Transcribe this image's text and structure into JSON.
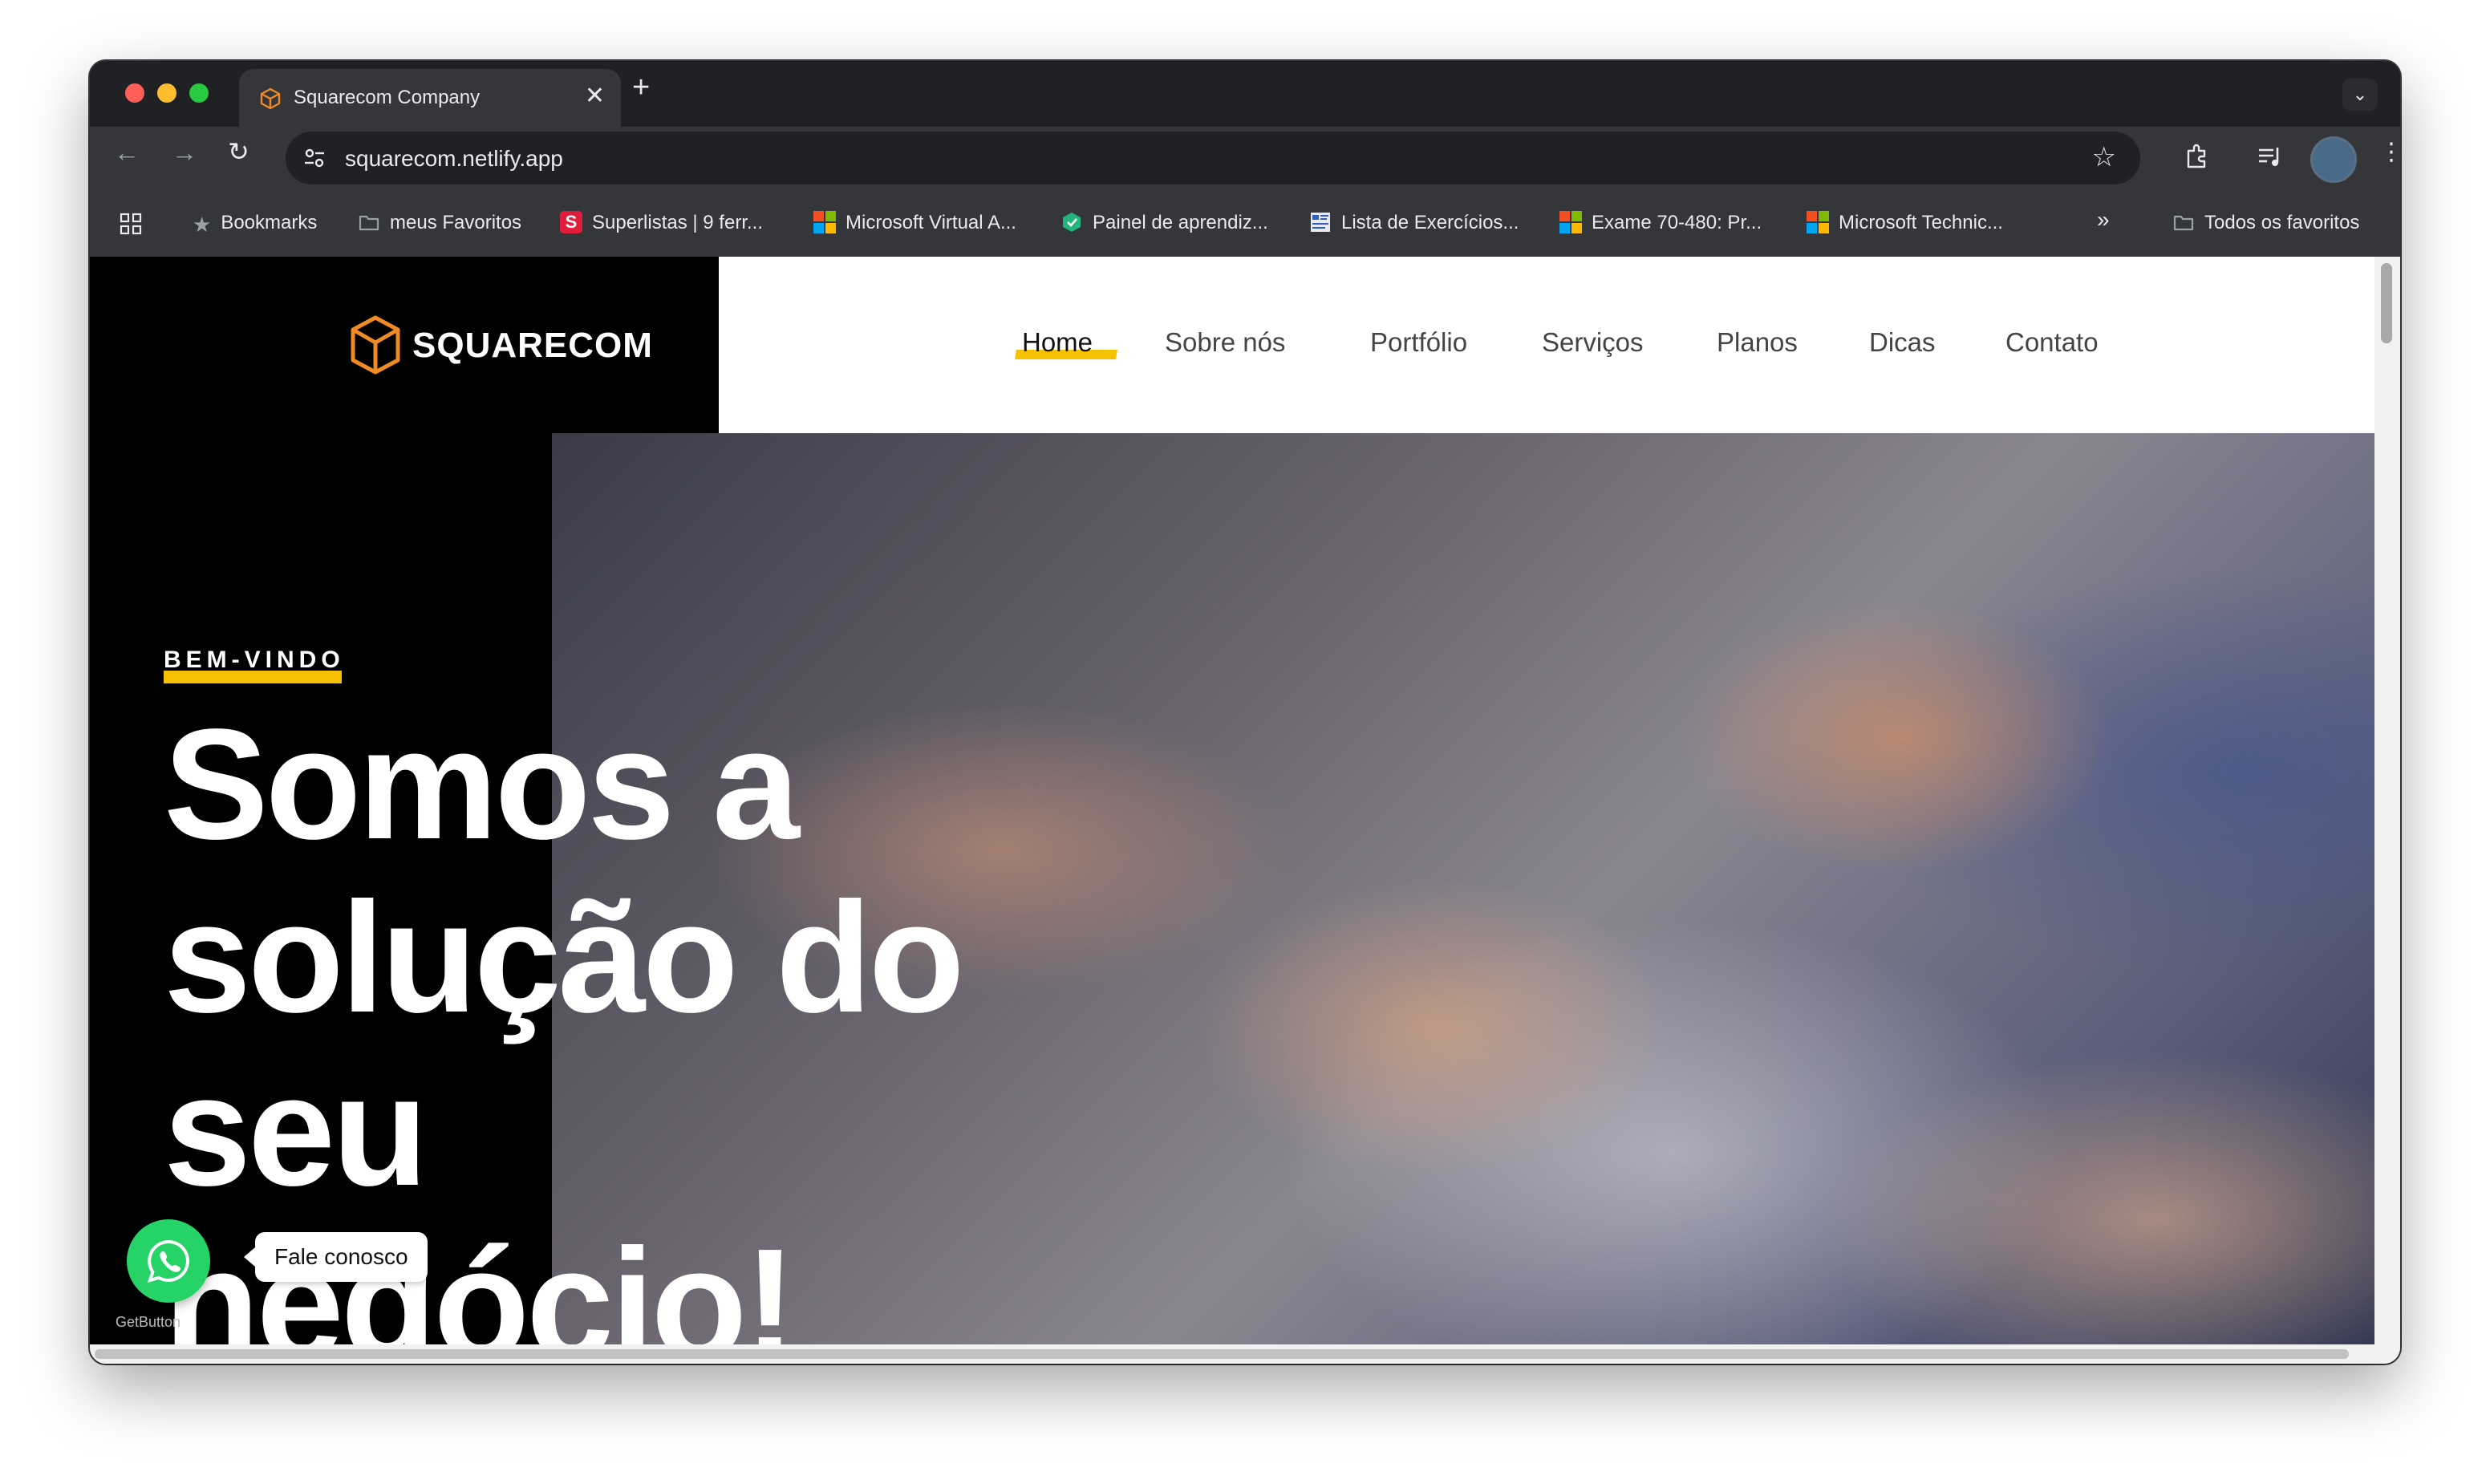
{
  "browser": {
    "tab_title": "Squarecom Company",
    "tab_close": "✕",
    "new_tab": "+",
    "tab_menu": "⌄",
    "url": "squarecom.netlify.app",
    "bookmarks": [
      {
        "label": "Bookmarks",
        "icon": "star-icon"
      },
      {
        "label": "meus Favoritos",
        "icon": "folder-icon"
      },
      {
        "label": "Superlistas | 9 ferr...",
        "icon": "superlistas-icon"
      },
      {
        "label": "Microsoft Virtual A...",
        "icon": "microsoft-icon"
      },
      {
        "label": "Painel de aprendiz...",
        "icon": "painel-icon"
      },
      {
        "label": "Lista de Exercícios...",
        "icon": "lista-icon"
      },
      {
        "label": "Exame 70-480: Pr...",
        "icon": "microsoft-icon"
      },
      {
        "label": "Microsoft Technic...",
        "icon": "microsoft-icon"
      }
    ],
    "bookmarks_overflow": "»",
    "all_bookmarks": "Todos os favoritos"
  },
  "site": {
    "logo_text": "SQUARECOM",
    "nav": [
      "Home",
      "Sobre nós",
      "Portfólio",
      "Serviços",
      "Planos",
      "Dicas",
      "Contato"
    ],
    "active_nav": "Home",
    "kicker": "BEM-VINDO",
    "headline_lines": [
      "Somos a",
      "solução do",
      "seu",
      "negócio!"
    ],
    "whatsapp_label": "Fale conosco",
    "getbutton_label": "GetButton"
  },
  "colors": {
    "accent": "#f5c100",
    "logo_orange": "#f08a24",
    "whatsapp": "#25d366"
  }
}
